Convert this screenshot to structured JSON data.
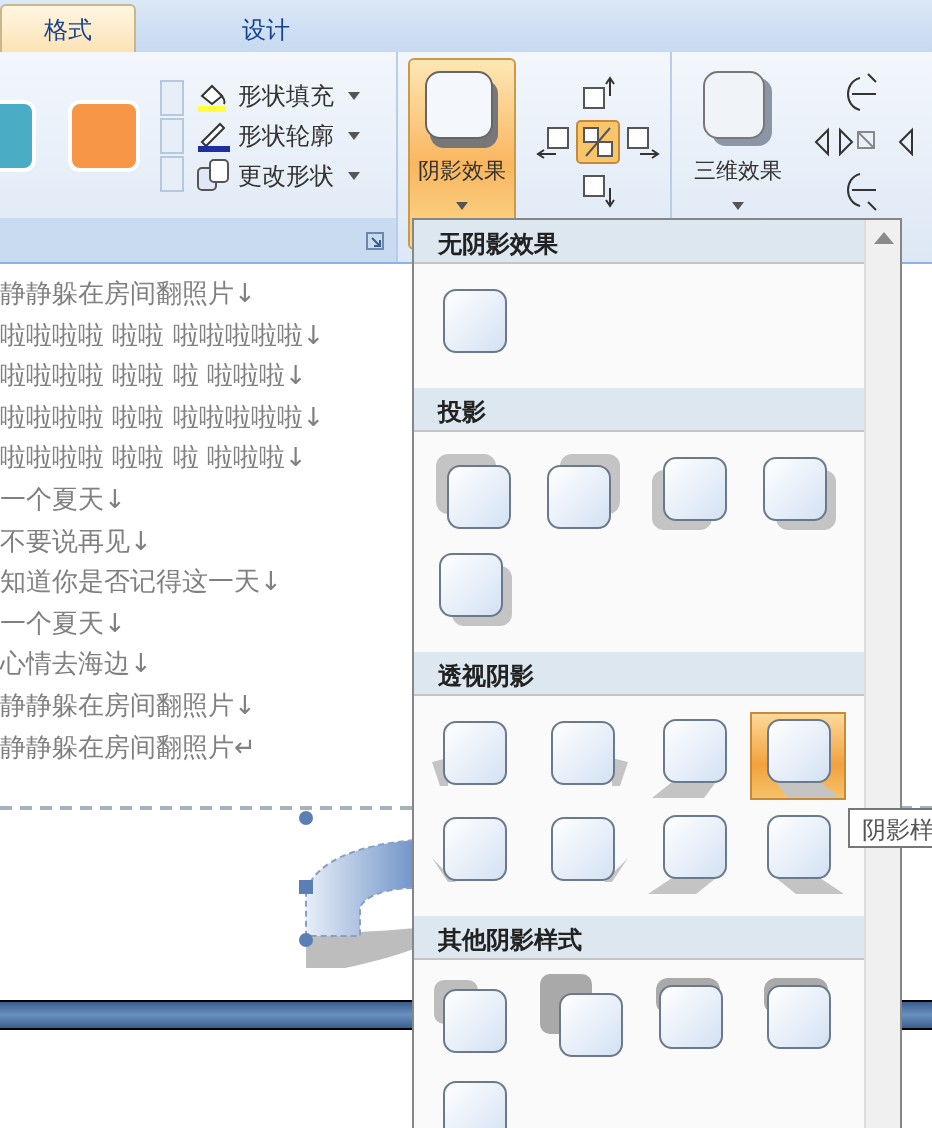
{
  "tabs": [
    {
      "label": "格式",
      "selected": true
    },
    {
      "label": "设计",
      "selected": false
    }
  ],
  "style_gallery": {
    "swatches": [
      {
        "color": "#4bacc6"
      },
      {
        "color": "#f79646"
      }
    ]
  },
  "shape_commands": [
    {
      "label": "形状填充",
      "kind": "fill"
    },
    {
      "label": "形状轮廓",
      "kind": "outline"
    },
    {
      "label": "更改形状",
      "kind": "change"
    }
  ],
  "shadow_button": {
    "label": "阴影效果",
    "pressed": true
  },
  "shadow_toggle": {
    "on": true
  },
  "effects_3d_button": {
    "label": "三维效果",
    "pressed": false
  },
  "document_lines": [
    "静静躲在房间翻照片↓",
    "啦啦啦啦 啦啦 啦啦啦啦啦↓",
    "啦啦啦啦 啦啦 啦 啦啦啦↓",
    "啦啦啦啦 啦啦 啦啦啦啦啦↓",
    "啦啦啦啦 啦啦 啦 啦啦啦↓",
    "一个夏天↓",
    "不要说再见↓",
    "知道你是否记得这一天↓",
    "一个夏天↓",
    "心情去海边↓",
    "静静躲在房间翻照片↓",
    "静静躲在房间翻照片↵"
  ],
  "shadow_menu": {
    "sections": [
      {
        "title": "无阴影效果",
        "items": [
          {
            "kind": "plain",
            "selected": false
          }
        ]
      },
      {
        "title": "投影",
        "items": [
          {
            "kind": "drop-nw",
            "selected": false
          },
          {
            "kind": "drop-ne",
            "selected": false
          },
          {
            "kind": "drop-sw",
            "selected": false
          },
          {
            "kind": "drop-se",
            "selected": false
          },
          {
            "kind": "drop-se",
            "selected": false
          }
        ]
      },
      {
        "title": "透视阴影",
        "items": [
          {
            "kind": "persp-left",
            "selected": false
          },
          {
            "kind": "persp-right",
            "selected": false
          },
          {
            "kind": "persp-below-left",
            "selected": false
          },
          {
            "kind": "persp-below-right",
            "selected": true
          },
          {
            "kind": "persp-low-left",
            "selected": false
          },
          {
            "kind": "persp-low-right",
            "selected": false
          },
          {
            "kind": "persp-under-left",
            "selected": false
          },
          {
            "kind": "persp-under-right",
            "selected": false
          }
        ]
      },
      {
        "title": "其他阴影样式",
        "items": [
          {
            "kind": "double-nw",
            "selected": false
          },
          {
            "kind": "double-far",
            "selected": false
          },
          {
            "kind": "double-top",
            "selected": false
          },
          {
            "kind": "double-top",
            "selected": false
          },
          {
            "kind": "plain",
            "selected": false
          }
        ]
      }
    ]
  },
  "tooltip": "阴影样"
}
